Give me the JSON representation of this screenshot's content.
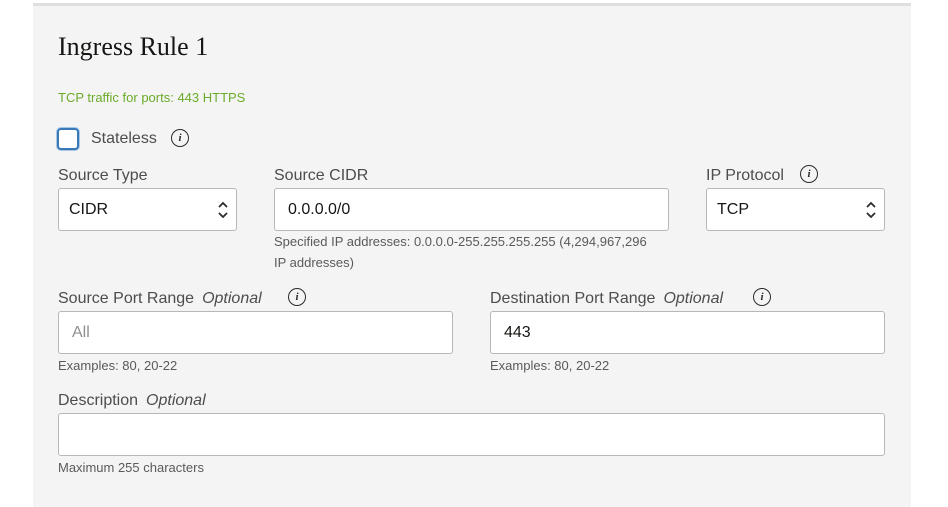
{
  "rule": {
    "title": "Ingress Rule 1",
    "summary": "TCP traffic for ports: 443 HTTPS"
  },
  "stateless": {
    "label": "Stateless",
    "checked": false
  },
  "source_type": {
    "label": "Source Type",
    "value": "CIDR"
  },
  "source_cidr": {
    "label": "Source CIDR",
    "value": "0.0.0.0/0",
    "help_line1": "Specified IP addresses: 0.0.0.0-255.255.255.255 (4,294,967,296",
    "help_line2": "IP addresses)"
  },
  "ip_protocol": {
    "label": "IP Protocol",
    "value": "TCP"
  },
  "source_port_range": {
    "label": "Source Port Range",
    "optional": "Optional",
    "placeholder": "All",
    "value": "",
    "help": "Examples: 80, 20-22"
  },
  "destination_port_range": {
    "label": "Destination Port Range",
    "optional": "Optional",
    "value": "443",
    "help": "Examples: 80, 20-22"
  },
  "description": {
    "label": "Description",
    "optional": "Optional",
    "value": "",
    "help": "Maximum 255 characters"
  },
  "colors": {
    "accent": "#3a78b7",
    "summary": "#6bab2a",
    "panel": "#f4f4f4"
  },
  "icons": {
    "info": "info-icon",
    "select": "chevron-up-down-icon"
  }
}
